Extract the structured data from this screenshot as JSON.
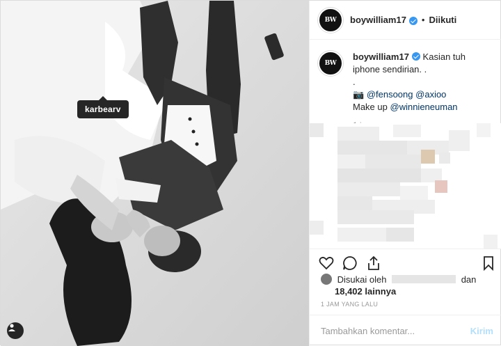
{
  "photo": {
    "tag_username": "karbearv"
  },
  "header": {
    "avatar_text": "BW",
    "username": "boywilliam17",
    "separator": "•",
    "follow_status": "Diikuti"
  },
  "caption": {
    "username": "boywilliam17",
    "line1": "Kasian tuh iphone sendirian. .",
    "line2": ".",
    "camera_emoji": "📷",
    "mention1": "@fensoong",
    "mention2": "@axioo",
    "makeup_label": "Make up",
    "mention3": "@winnieneuman",
    "time": "1 jam"
  },
  "likes": {
    "prefix": "Disukai oleh",
    "suffix": "dan",
    "count": "18,402 lainnya"
  },
  "timestamp": "1 JAM YANG LALU",
  "comment_box": {
    "placeholder": "Tambahkan komentar...",
    "post_label": "Kirim"
  },
  "colors": {
    "verified": "#3897f0",
    "mention": "#003569",
    "post_disabled": "#b2dffc"
  },
  "icons": [
    "heart-icon",
    "comment-icon",
    "share-icon",
    "bookmark-icon",
    "user-tag-icon",
    "verified-badge-icon"
  ]
}
